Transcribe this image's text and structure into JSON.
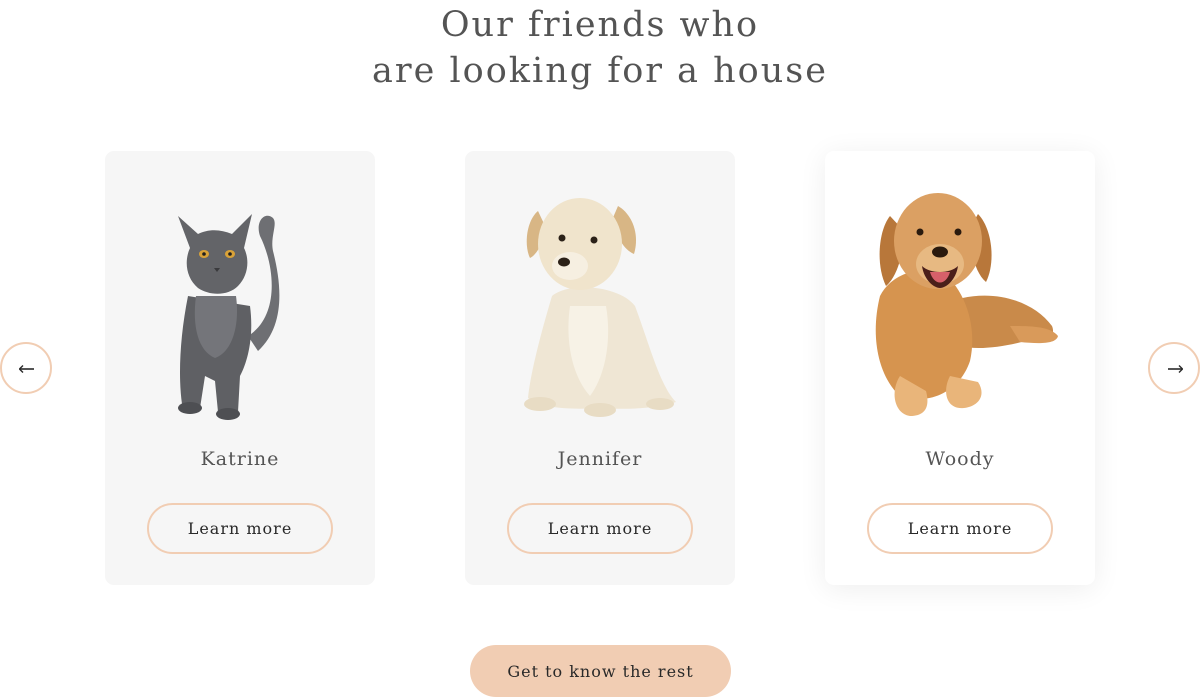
{
  "section": {
    "title_line1": "Our friends who",
    "title_line2": "are looking for a house"
  },
  "colors": {
    "accent": "#f1cdb3",
    "card_bg": "#f6f6f6",
    "title_text": "#545454",
    "button_text": "#292929"
  },
  "slider": {
    "prev_icon": "arrow-left-icon",
    "next_icon": "arrow-right-icon",
    "cards": [
      {
        "name": "Katrine",
        "image": "gray-cat",
        "button_label": "Learn more"
      },
      {
        "name": "Jennifer",
        "image": "cream-puppy",
        "button_label": "Learn more"
      },
      {
        "name": "Woody",
        "image": "golden-retriever",
        "button_label": "Learn more"
      }
    ]
  },
  "cta": {
    "label": "Get to know the rest"
  }
}
